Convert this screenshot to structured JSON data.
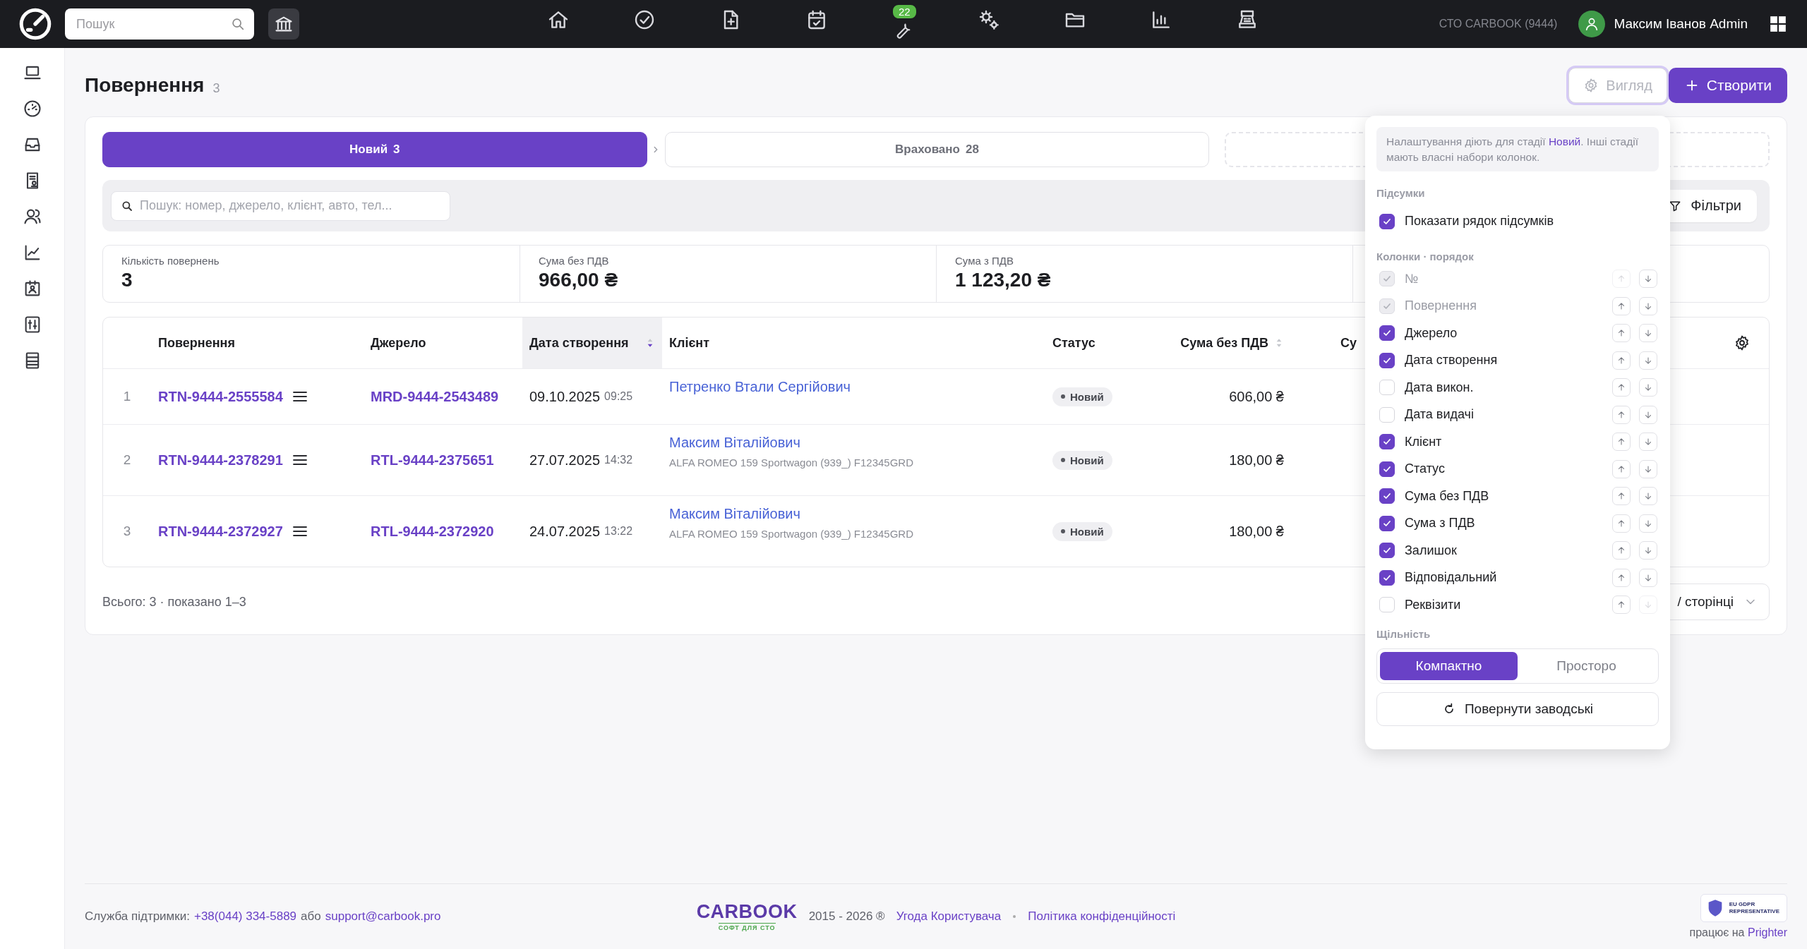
{
  "topbar": {
    "search": {
      "placeholder": "Пошук"
    },
    "nav": [
      {
        "kind": "home"
      },
      {
        "kind": "check"
      },
      {
        "kind": "file-plus"
      },
      {
        "kind": "calendar"
      },
      {
        "kind": "wrench",
        "badge": "22"
      },
      {
        "kind": "gears"
      },
      {
        "kind": "folder"
      },
      {
        "kind": "chart"
      },
      {
        "kind": "register"
      }
    ],
    "company": "СТО CARBOOK (9444)",
    "user": "Максим Іванов Admin"
  },
  "sidebar": {
    "items": [
      {
        "kind": "laptop"
      },
      {
        "kind": "gauge"
      },
      {
        "kind": "inbox"
      },
      {
        "kind": "report"
      },
      {
        "kind": "users"
      },
      {
        "kind": "trend"
      },
      {
        "kind": "id-card"
      },
      {
        "kind": "sliders"
      },
      {
        "kind": "list"
      }
    ]
  },
  "page": {
    "title": "Повернення",
    "count": "3",
    "actions": [
      {
        "kind": "view",
        "label": "Вигляд",
        "active": true
      },
      {
        "kind": "create",
        "label": "Створити"
      }
    ]
  },
  "stages": [
    {
      "label": "Новий",
      "count": "3",
      "selected": true
    },
    {
      "label": "Враховано",
      "count": "28",
      "selected": false
    }
  ],
  "empty_stage_slot": true,
  "search": {
    "placeholder": "Пошук: номер, джерело, клієнт, авто, тел..."
  },
  "filters_button": "Фільтри",
  "summary": [
    {
      "label": "Кількість повернень",
      "value": "3"
    },
    {
      "label": "Сума без ПДВ",
      "value": "966,00 ₴"
    },
    {
      "label": "Сума з ПДВ",
      "value": "1 123,20 ₴"
    }
  ],
  "table": {
    "columns": [
      {
        "label": "Повернення"
      },
      {
        "label": "Джерело"
      },
      {
        "label": "Дата створення",
        "sorted": true
      },
      {
        "label": "Клієнт"
      },
      {
        "label": "Статус"
      },
      {
        "label": "Сума без ПДВ",
        "sorted": false
      },
      {
        "label": "Су"
      }
    ],
    "rows": [
      {
        "index": "1",
        "number": "RTN-9444-2555584",
        "source": "MRD-9444-2543489",
        "date": "09.10.2025",
        "time": "09:25",
        "client": "Петренко Втали Сергійович",
        "status": "Новий",
        "amount": "606,00 ₴"
      },
      {
        "index": "2",
        "number": "RTN-9444-2378291",
        "source": "RTL-9444-2375651",
        "date": "27.07.2025",
        "time": "14:32",
        "client": "Максим Віталійович",
        "vehicle": "ALFA ROMEO 159 Sportwagon (939_) F12345GRD",
        "status": "Новий",
        "amount": "180,00 ₴"
      },
      {
        "index": "3",
        "number": "RTN-9444-2372927",
        "source": "RTL-9444-2372920",
        "date": "24.07.2025",
        "time": "13:22",
        "client": "Максим Віталійович",
        "vehicle": "ALFA ROMEO 159 Sportwagon (939_) F12345GRD",
        "status": "Новий",
        "amount": "180,00 ₴"
      }
    ]
  },
  "pagination": {
    "summary": "Всього: 3 · показано 1–3",
    "page_size": "/ сторінці"
  },
  "view_panel": {
    "note": {
      "before": "Налаштування діють для стадії ",
      "stage": "Новий",
      "after": ". Інші стадії мають власні набори колонок."
    },
    "totals_title": "Підсумки",
    "show_totals": {
      "label": "Показати рядок підсумків",
      "checked": true
    },
    "columns_title": "Колонки · порядок",
    "columns": [
      {
        "label": "№",
        "checked": true,
        "disabled": true,
        "up_enabled": false,
        "down_enabled": true
      },
      {
        "label": "Повернення",
        "checked": true,
        "disabled": true,
        "up_enabled": true,
        "down_enabled": true
      },
      {
        "label": "Джерело",
        "checked": true,
        "disabled": false,
        "up_enabled": true,
        "down_enabled": true
      },
      {
        "label": "Дата створення",
        "checked": true,
        "disabled": false,
        "up_enabled": true,
        "down_enabled": true
      },
      {
        "label": "Дата викон.",
        "checked": false,
        "disabled": false,
        "up_enabled": true,
        "down_enabled": true
      },
      {
        "label": "Дата видачі",
        "checked": false,
        "disabled": false,
        "up_enabled": true,
        "down_enabled": true
      },
      {
        "label": "Клієнт",
        "checked": true,
        "disabled": false,
        "up_enabled": true,
        "down_enabled": true
      },
      {
        "label": "Статус",
        "checked": true,
        "disabled": false,
        "up_enabled": true,
        "down_enabled": true
      },
      {
        "label": "Сума без ПДВ",
        "checked": true,
        "disabled": false,
        "up_enabled": true,
        "down_enabled": true
      },
      {
        "label": "Сума з ПДВ",
        "checked": true,
        "disabled": false,
        "up_enabled": true,
        "down_enabled": true
      },
      {
        "label": "Залишок",
        "checked": true,
        "disabled": false,
        "up_enabled": true,
        "down_enabled": true
      },
      {
        "label": "Відповідальний",
        "checked": true,
        "disabled": false,
        "up_enabled": true,
        "down_enabled": true
      },
      {
        "label": "Реквізити",
        "checked": false,
        "disabled": false,
        "up_enabled": true,
        "down_enabled": false
      }
    ],
    "density_title": "Щільність",
    "density": [
      {
        "label": "Компактно",
        "selected": true
      },
      {
        "label": "Просторо",
        "selected": false
      }
    ],
    "reset": "Повернути заводські"
  },
  "footer": {
    "support_label": "Служба підтримки:",
    "phone": "+38(044) 334-5889",
    "or": "або",
    "email": "support@carbook.pro",
    "brand": "CARBOOK",
    "brand_tagline": "СОФТ ДЛЯ СТО",
    "years": "2015 - 2026 ®",
    "links": [
      "Угода Користувача",
      "Політика конфіденційності"
    ],
    "badge_title": "EU GDPR",
    "badge_subtitle": "REPRESENTATIVE",
    "powered_by": "працює на",
    "powered_link": "Prighter"
  }
}
